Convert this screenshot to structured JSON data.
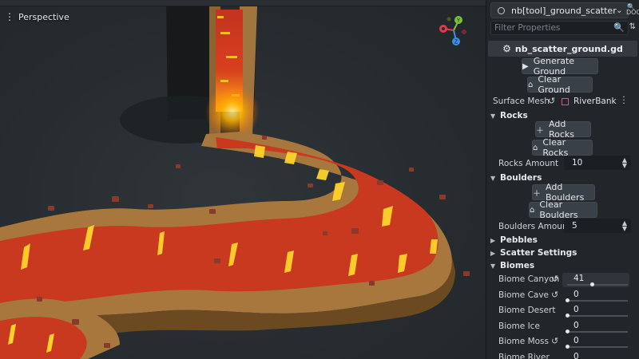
{
  "viewport": {
    "menu_icon": "kebab-icon",
    "perspective_label": "Perspective",
    "gizmo": {
      "y": "Y",
      "z": "Z",
      "x_color": "#e5384c",
      "y_color": "#79c238",
      "z_color": "#3a8ee6"
    }
  },
  "inspector": {
    "node_name": "nb[tool]_ground_scatter",
    "filter_placeholder": "Filter Properties",
    "script_name": "nb_scatter_ground.gd",
    "generate_ground": "Generate Ground",
    "clear_ground": "Clear Ground",
    "surface_mesh_label": "Surface Mesh",
    "surface_mesh_value": "RiverBank",
    "rocks_section": "Rocks",
    "add_rocks": "Add Rocks",
    "clear_rocks": "Clear Rocks",
    "rocks_amount_label": "Rocks Amount",
    "rocks_amount_value": "10",
    "boulders_section": "Boulders",
    "add_boulders": "Add Boulders",
    "clear_boulders": "Clear Boulders",
    "boulders_amount_label": "Boulders Amount",
    "boulders_amount_value": "5",
    "pebbles_section": "Pebbles",
    "scatter_settings_section": "Scatter Settings",
    "biomes_section": "Biomes",
    "biomes": [
      {
        "label": "Biome Canyon",
        "value": "41",
        "fraction": 0.41
      },
      {
        "label": "Biome Cave",
        "value": "0",
        "fraction": 0
      },
      {
        "label": "Biome Desert",
        "value": "0",
        "fraction": 0
      },
      {
        "label": "Biome Ice",
        "value": "0",
        "fraction": 0
      },
      {
        "label": "Biome Moss",
        "value": "0",
        "fraction": 0
      },
      {
        "label": "Biome River",
        "value": "0",
        "fraction": 0
      }
    ]
  }
}
